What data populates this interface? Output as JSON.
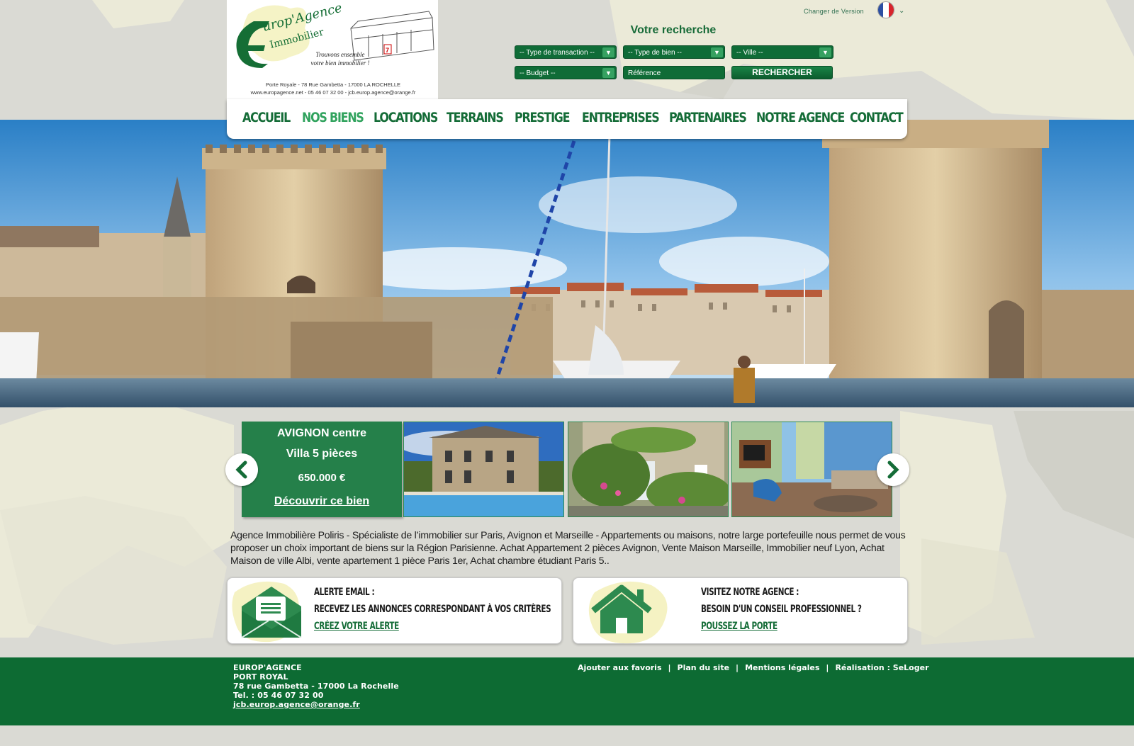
{
  "logo": {
    "brand_line1": "Europ'Agence",
    "brand_line2": "Immobilier",
    "slogan_line1": "Trouvons ensemble",
    "slogan_line2": "votre bien immobilier !",
    "address": "Porte Royale - 78 Rue Gambetta - 17000 LA ROCHELLE",
    "contact": "www.europagence.net - 05 46 07 32 00 - jcb.europ.agence@orange.fr"
  },
  "header": {
    "version_label": "Changer de Version",
    "flag_icon": "france-flag-icon"
  },
  "search": {
    "title": "Votre recherche",
    "transaction": "-- Type de transaction --",
    "property_type": "-- Type de bien --",
    "city": "-- Ville --",
    "budget": "-- Budget --",
    "reference_placeholder": "Référence",
    "submit_label": "RECHERCHER"
  },
  "nav": {
    "items": [
      "Accueil",
      "Nos biens",
      "Locations",
      "Terrains",
      "Prestige",
      "Entreprises",
      "Partenaires",
      "Notre agence",
      "Contact"
    ],
    "active_index": 1
  },
  "carousel": {
    "featured": {
      "city": "AVIGNON centre",
      "type": "Villa 5 pièces",
      "price": "650.000 €",
      "link": "Découvrir ce bien"
    }
  },
  "description": "Agence Immobilière Poliris - Spécialiste de l’immobilier sur Paris, Avignon et Marseille - Appartements ou maisons, notre large portefeuille nous permet de vous proposer un choix important de biens sur la Région Parisienne. Achat Appartement 2 pièces Avignon, Vente Maison Marseille, Immobilier neuf Lyon, Achat Maison de ville Albi, vente apartement 1 pièce Paris 1er, Achat chambre étudiant Paris 5..",
  "cards": {
    "alert": {
      "title": "Alerte email :",
      "subtitle": "Recevez les annonces correspondant à vos critères",
      "link": "Créez votre alerte"
    },
    "visit": {
      "title": "Visitez notre agence :",
      "subtitle": "Besoin d'un conseil professionnel ?",
      "link": "Poussez la porte"
    }
  },
  "footer": {
    "name": "EUROP'AGENCE",
    "place": "PORT ROYAL",
    "address": "78 rue Gambetta  -  17000 La Rochelle",
    "phone": "Tel. : 05 46 07 32 00",
    "email": "jcb.europ.agence@orange.fr",
    "links": [
      "Ajouter aux favoris",
      "Plan du site",
      "Mentions légales",
      "Réalisation : SeLoger"
    ]
  },
  "colors": {
    "brand_green": "#146c37",
    "accent_green": "#31a35e",
    "footer_green": "#0d6b33"
  }
}
